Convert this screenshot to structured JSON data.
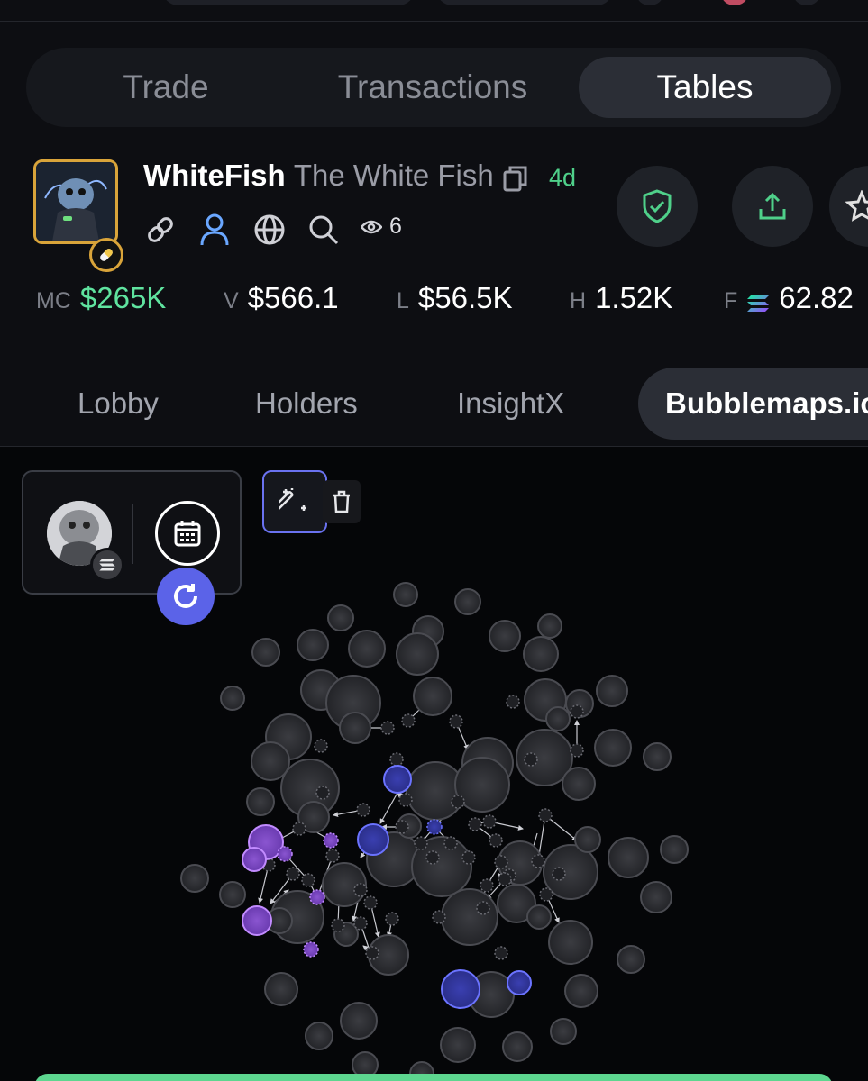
{
  "segmented": {
    "tabs": [
      {
        "label": "Trade",
        "active": false
      },
      {
        "label": "Transactions",
        "active": false
      },
      {
        "label": "Tables",
        "active": true
      }
    ]
  },
  "token": {
    "name": "WhiteFish",
    "full_name": "The White Fish",
    "age": "4d",
    "views": "6"
  },
  "links": [
    "link-icon",
    "user-icon",
    "globe-icon",
    "search-icon"
  ],
  "actions": [
    "shield-check-icon",
    "share-icon",
    "star-icon"
  ],
  "stats": [
    {
      "label": "MC",
      "value": "$265K",
      "color": "#5fe39f"
    },
    {
      "label": "V",
      "value": "$566.1"
    },
    {
      "label": "L",
      "value": "$56.5K"
    },
    {
      "label": "H",
      "value": "1.52K"
    },
    {
      "label": "F",
      "value": "62.82"
    }
  ],
  "subtabs": [
    {
      "label": "Lobby",
      "active": false
    },
    {
      "label": "Holders",
      "active": false
    },
    {
      "label": "InsightX",
      "active": false
    },
    {
      "label": "Bubblemaps.io",
      "active": true
    }
  ],
  "colors": {
    "accent": "#5b63e8",
    "positive": "#5fe39f",
    "bubble_blue": "#4b52d8",
    "bubble_purple": "#9f5fe0",
    "avatar_border": "#d9a43a"
  }
}
